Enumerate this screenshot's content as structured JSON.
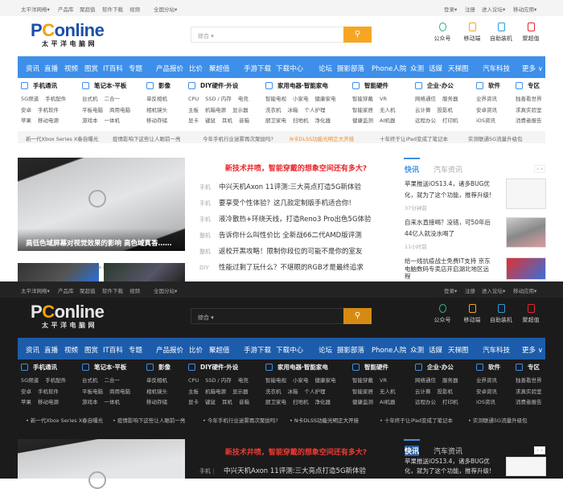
{
  "topbar": {
    "left": [
      "太平洋网络▾",
      "产品库",
      "聚超值",
      "软件下载",
      "视频",
      "全国分站▾"
    ],
    "right": [
      "登录▾",
      "注册",
      "进入论坛▾",
      "移动应用▾"
    ]
  },
  "logo": {
    "word": "PConline",
    "sub": "太平洋电脑网"
  },
  "search": {
    "placeholder": "综合 ▾",
    "button_icon": "search-icon"
  },
  "quick": [
    {
      "label": "公众号",
      "color": "#36b37e"
    },
    {
      "label": "移动端",
      "color": "#f5a623"
    },
    {
      "label": "自助装机",
      "color": "#2d9cdb"
    },
    {
      "label": "聚超值",
      "color": "#e8262c"
    }
  ],
  "nav": {
    "items": [
      "资讯",
      "直播",
      "视频",
      "图赏",
      "IT百科",
      "专题",
      "产品报价",
      "比价",
      "聚超值",
      "手游下载",
      "下载中心",
      "论坛",
      "摄影部落",
      "Phone人院",
      "众测",
      "话媒",
      "天梯图",
      "汽车科技"
    ],
    "more": "更多 ∨"
  },
  "categories": [
    {
      "title": "手机通讯",
      "rows": [
        [
          "5G频道",
          "手机配件"
        ],
        [
          "安卓",
          "手机软件"
        ],
        [
          "苹果",
          "移动电源"
        ]
      ]
    },
    {
      "title": "笔记本·平板",
      "rows": [
        [
          "台式机",
          "二合一"
        ],
        [
          "平板电脑",
          "商用电脑"
        ],
        [
          "游戏本",
          "一体机"
        ]
      ]
    },
    {
      "title": "影像",
      "rows": [
        [
          "单反相机"
        ],
        [
          "相机镜头"
        ],
        [
          "移动存储"
        ]
      ]
    },
    {
      "title": "DIY硬件·外设",
      "rows": [
        [
          "CPU",
          "SSD / 内存",
          "电竞"
        ],
        [
          "主板",
          "机箱电源",
          "显示器"
        ],
        [
          "显卡",
          "键鼠",
          "耳机",
          "音箱"
        ]
      ]
    },
    {
      "title": "家用电器·智能家电",
      "rows": [
        [
          "智能电视",
          "小家电",
          "健康家电"
        ],
        [
          "洗衣机",
          "冰箱",
          "个人护理"
        ],
        [
          "厨卫家电",
          "扫地机",
          "净化器"
        ]
      ]
    },
    {
      "title": "智能硬件",
      "rows": [
        [
          "智能穿戴",
          "VR"
        ],
        [
          "智能家居",
          "无人机"
        ],
        [
          "健康监测",
          "AI机器"
        ]
      ]
    },
    {
      "title": "企业·办公",
      "rows": [
        [
          "网络通信",
          "服务器"
        ],
        [
          "云计算",
          "投影机"
        ],
        [
          "远程办公",
          "打印机"
        ]
      ]
    },
    {
      "title": "软件",
      "rows": [
        [
          "业界资讯"
        ],
        [
          "安卓资讯"
        ],
        [
          "iOS资讯"
        ]
      ]
    },
    {
      "title": "专区",
      "rows": [
        [
          "独善看世界"
        ],
        [
          "求真实验室"
        ],
        [
          "消费者报告"
        ]
      ]
    }
  ],
  "ticker": [
    "新一代Xbox Series X春自曝光",
    "疫情影响下这些让人眼前一亮",
    "今年手机行业迷雾再次聚拢吗?",
    "N卡DLSS功能光明正大开挂",
    "十年终于让iPad变成了笔记本",
    "实测联通5G流量升级包"
  ],
  "hero": {
    "caption": "高低色域屏幕对视觉效果的影响 高色域真香……",
    "slides": 8,
    "active": 1
  },
  "headline": "新技术井喷，智能穿戴的想象空间还有多大?",
  "news": [
    {
      "tag": "手机",
      "title": "中兴天机Axon 11评测:三大亮点打造5G新体验"
    },
    {
      "tag": "手机",
      "title": "要享受个性体验？这几款定制版手机适合你!"
    },
    {
      "tag": "手机",
      "title": "液冷散热+环绕天线，打造Reno3 Pro出色5G体验"
    },
    {
      "tag": "整机",
      "title": "告诉你什么叫性价比 全新战66二代AMD版评测"
    },
    {
      "tag": "整机",
      "title": "返校开黑攻略！限制你段位的可能不是你的室友"
    },
    {
      "tag": "DIY",
      "title": "性能过剩了玩什么？不堪眼的RGB才是最终追求"
    }
  ],
  "right": {
    "tabs": [
      "快讯",
      "汽车资讯"
    ],
    "arrows": "‹  ›",
    "items": [
      {
        "title": "苹果推送iOS13.4，诸多BUG优化，就为了这个功能，推荐升级!",
        "time": "37分钟前"
      },
      {
        "title": "自来水直接喝？没错，可50年后44亿人就没水喝了",
        "time": "11小时前"
      },
      {
        "title": "给一线抗疫战士免费IT支持 京东电脑数码专卖店开启湖北地区远程"
      }
    ]
  }
}
